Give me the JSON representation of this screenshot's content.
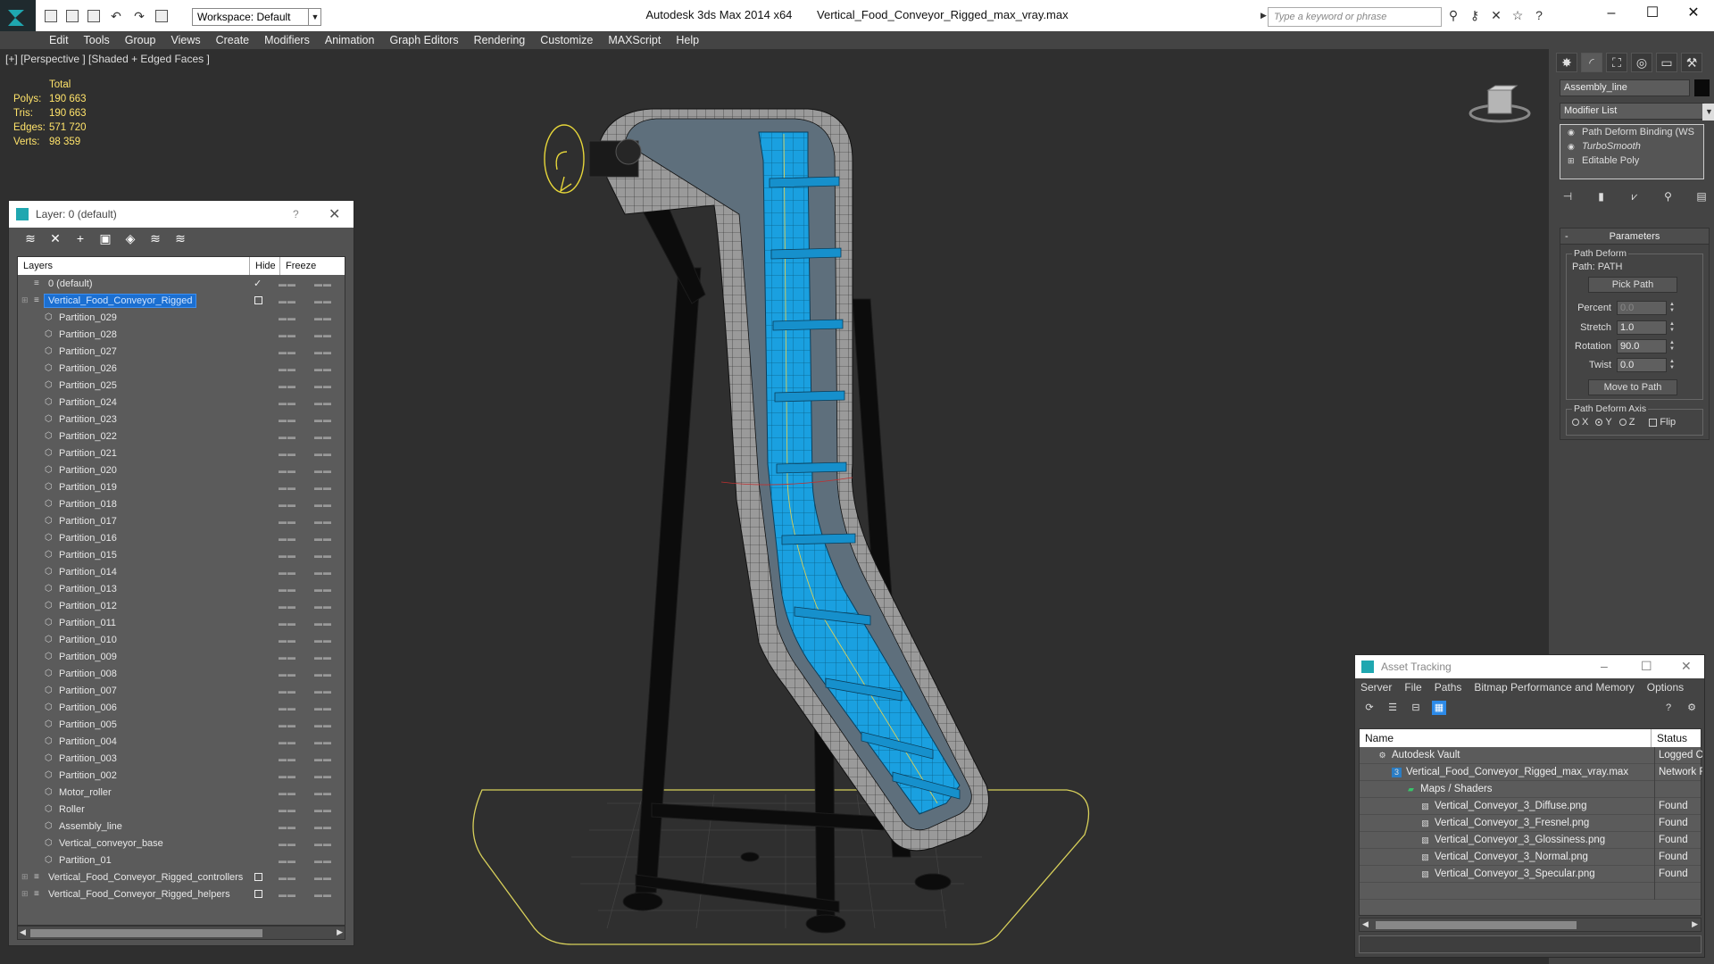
{
  "window": {
    "app_title": "Autodesk 3ds Max  2014 x64",
    "file_title": "Vertical_Food_Conveyor_Rigged_max_vray.max",
    "workspace": "Workspace: Default",
    "search_placeholder": "Type a keyword or phrase"
  },
  "menu": [
    "Edit",
    "Tools",
    "Group",
    "Views",
    "Create",
    "Modifiers",
    "Animation",
    "Graph Editors",
    "Rendering",
    "Customize",
    "MAXScript",
    "Help"
  ],
  "viewport": {
    "label": "[+] [Perspective ] [Shaded + Edged Faces ]",
    "stats": {
      "header": "Total",
      "rows": [
        {
          "k": "Polys:",
          "v": "190 663"
        },
        {
          "k": "Tris:",
          "v": "190 663"
        },
        {
          "k": "Edges:",
          "v": "571 720"
        },
        {
          "k": "Verts:",
          "v": "98 359"
        }
      ]
    }
  },
  "layer_window": {
    "title": "Layer: 0 (default)",
    "help": "?",
    "columns": {
      "layers": "Layers",
      "hide": "Hide",
      "freeze": "Freeze"
    },
    "rows": [
      {
        "name": "0 (default)",
        "level": 0,
        "current": true
      },
      {
        "name": "Vertical_Food_Conveyor_Rigged",
        "level": 0,
        "selected": true,
        "box": true,
        "expandable": true
      },
      {
        "name": "Partition_029",
        "level": 1
      },
      {
        "name": "Partition_028",
        "level": 1
      },
      {
        "name": "Partition_027",
        "level": 1
      },
      {
        "name": "Partition_026",
        "level": 1
      },
      {
        "name": "Partition_025",
        "level": 1
      },
      {
        "name": "Partition_024",
        "level": 1
      },
      {
        "name": "Partition_023",
        "level": 1
      },
      {
        "name": "Partition_022",
        "level": 1
      },
      {
        "name": "Partition_021",
        "level": 1
      },
      {
        "name": "Partition_020",
        "level": 1
      },
      {
        "name": "Partition_019",
        "level": 1
      },
      {
        "name": "Partition_018",
        "level": 1
      },
      {
        "name": "Partition_017",
        "level": 1
      },
      {
        "name": "Partition_016",
        "level": 1
      },
      {
        "name": "Partition_015",
        "level": 1
      },
      {
        "name": "Partition_014",
        "level": 1
      },
      {
        "name": "Partition_013",
        "level": 1
      },
      {
        "name": "Partition_012",
        "level": 1
      },
      {
        "name": "Partition_011",
        "level": 1
      },
      {
        "name": "Partition_010",
        "level": 1
      },
      {
        "name": "Partition_009",
        "level": 1
      },
      {
        "name": "Partition_008",
        "level": 1
      },
      {
        "name": "Partition_007",
        "level": 1
      },
      {
        "name": "Partition_006",
        "level": 1
      },
      {
        "name": "Partition_005",
        "level": 1
      },
      {
        "name": "Partition_004",
        "level": 1
      },
      {
        "name": "Partition_003",
        "level": 1
      },
      {
        "name": "Partition_002",
        "level": 1
      },
      {
        "name": "Motor_roller",
        "level": 1
      },
      {
        "name": "Roller",
        "level": 1
      },
      {
        "name": "Assembly_line",
        "level": 1
      },
      {
        "name": "Vertical_conveyor_base",
        "level": 1
      },
      {
        "name": "Partition_01",
        "level": 1
      },
      {
        "name": "Vertical_Food_Conveyor_Rigged_controllers",
        "level": 0,
        "box": true,
        "expandable": true
      },
      {
        "name": "Vertical_Food_Conveyor_Rigged_helpers",
        "level": 0,
        "box": true,
        "expandable": true
      }
    ]
  },
  "command_panel": {
    "object_name": "Assembly_line",
    "modifier_list": "Modifier List",
    "stack": [
      {
        "label": "Path Deform Binding (WS",
        "italic": false,
        "icon": "bulb"
      },
      {
        "label": "TurboSmooth",
        "italic": true,
        "icon": "bulb"
      },
      {
        "label": "Editable Poly",
        "italic": false,
        "icon": "plus"
      }
    ],
    "params": {
      "rollout_title": "Parameters",
      "rollout_marker": "-",
      "group_path_deform": "Path Deform",
      "path_label": "Path: PATH",
      "pick_path": "Pick Path",
      "percent": {
        "label": "Percent",
        "value": "0.0"
      },
      "stretch": {
        "label": "Stretch",
        "value": "1.0"
      },
      "rotation": {
        "label": "Rotation",
        "value": "90.0"
      },
      "twist": {
        "label": "Twist",
        "value": "0.0"
      },
      "move_to_path": "Move to Path",
      "group_axis": "Path Deform Axis",
      "axis_x": "X",
      "axis_y": "Y",
      "axis_z": "Z",
      "flip": "Flip"
    }
  },
  "asset_window": {
    "title": "Asset Tracking",
    "menu": [
      "Server",
      "File",
      "Paths",
      "Bitmap Performance and Memory",
      "Options"
    ],
    "columns": {
      "name": "Name",
      "status": "Status"
    },
    "rows": [
      {
        "name": "Autodesk Vault",
        "status": "Logged O",
        "indent": 20,
        "icon": "vault"
      },
      {
        "name": "Vertical_Food_Conveyor_Rigged_max_vray.max",
        "status": "Network F",
        "indent": 36,
        "icon": "max"
      },
      {
        "name": "Maps / Shaders",
        "status": "",
        "indent": 52,
        "icon": "folder"
      },
      {
        "name": "Vertical_Conveyor_3_Diffuse.png",
        "status": "Found",
        "indent": 68,
        "icon": "image"
      },
      {
        "name": "Vertical_Conveyor_3_Fresnel.png",
        "status": "Found",
        "indent": 68,
        "icon": "image"
      },
      {
        "name": "Vertical_Conveyor_3_Glossiness.png",
        "status": "Found",
        "indent": 68,
        "icon": "image"
      },
      {
        "name": "Vertical_Conveyor_3_Normal.png",
        "status": "Found",
        "indent": 68,
        "icon": "image"
      },
      {
        "name": "Vertical_Conveyor_3_Specular.png",
        "status": "Found",
        "indent": 68,
        "icon": "image"
      },
      {
        "name": "",
        "status": "",
        "indent": 0,
        "icon": ""
      }
    ]
  },
  "colors": {
    "viewport_bg": "#2f2f2f",
    "stats_text": "#ffe36a",
    "belt_blue": "#1aa0e0",
    "selection_blue": "#1b6fd1",
    "grid_outline": "#d8d05a"
  }
}
